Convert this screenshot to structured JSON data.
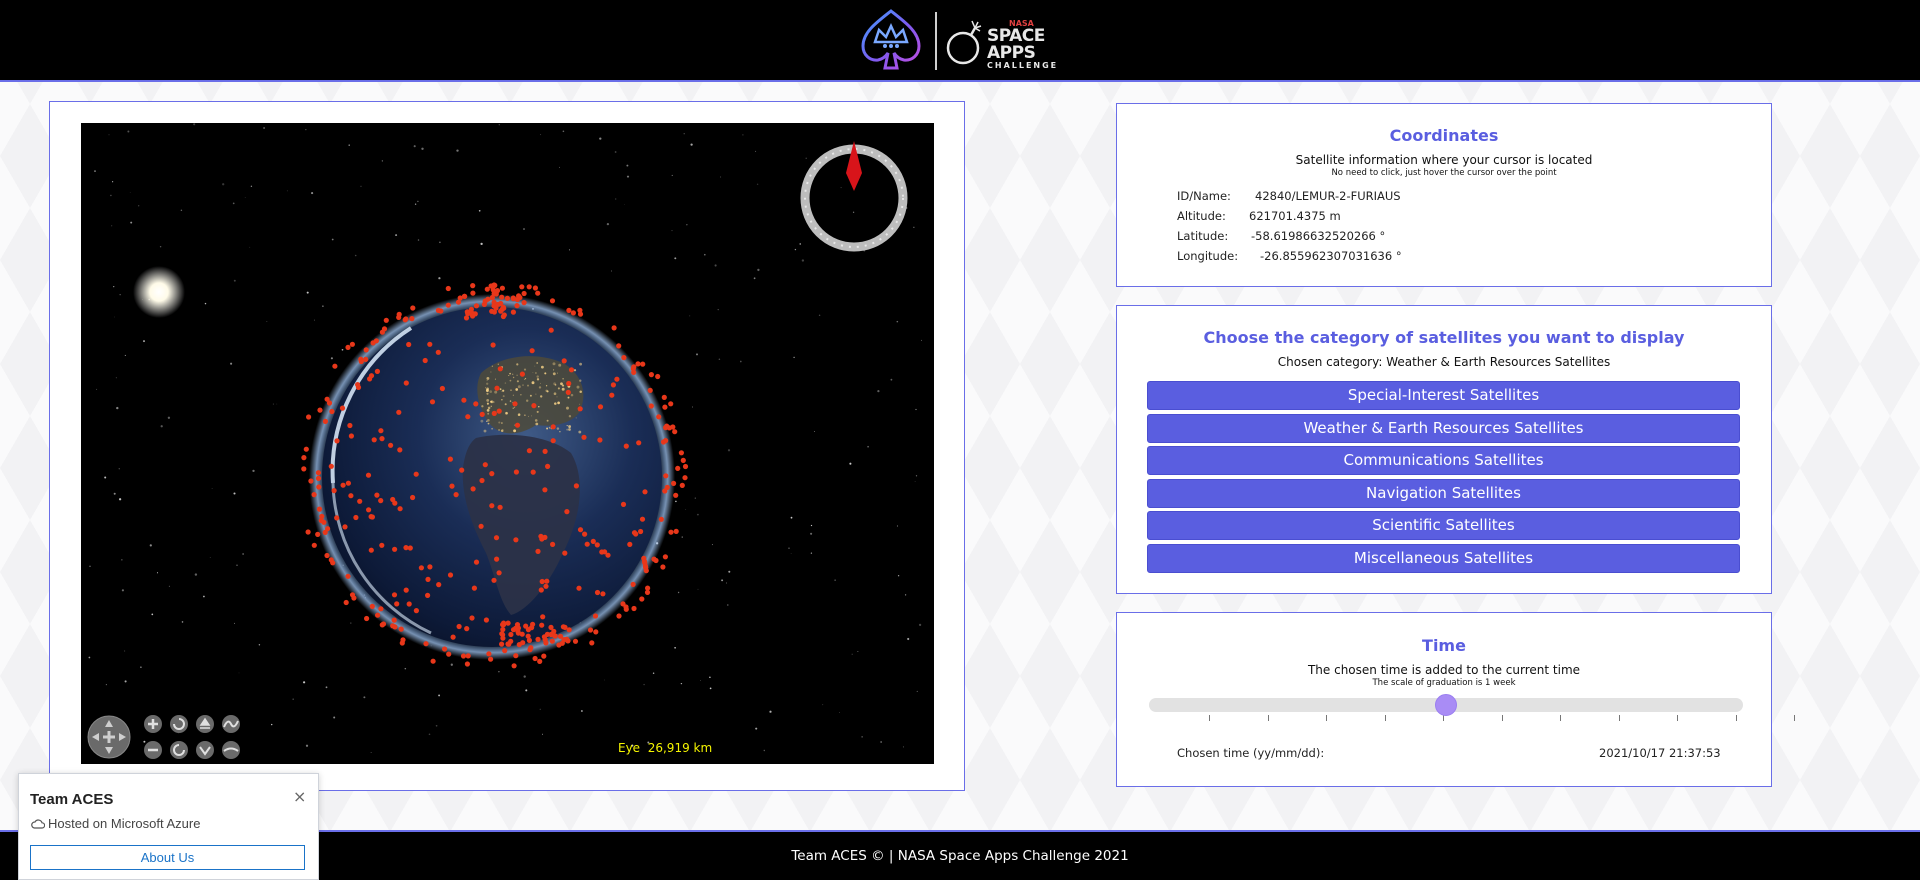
{
  "header": {
    "logo_text_small": "NASA",
    "logo_text_main": "SPACE APPS",
    "logo_text_sub": "CHALLENGE"
  },
  "viewer": {
    "eye_label": "Eye",
    "eye_distance": "26,919 km"
  },
  "coordinates": {
    "title": "Coordinates",
    "subtitle": "Satellite information where your cursor is located",
    "hint": "No need to click, just hover the cursor over the point",
    "rows": [
      {
        "label": "ID/Name:",
        "value": "42840/LEMUR-2-FURIAUS"
      },
      {
        "label": "Altitude:",
        "value": "621701.4375 m"
      },
      {
        "label": "Latitude:",
        "value": "-58.61986632520266 °"
      },
      {
        "label": "Longitude:",
        "value": "-26.855962307031636 °"
      }
    ]
  },
  "category": {
    "title": "Choose the category of satellites you want to display",
    "chosen_label": "Chosen category: Weather & Earth Resources Satellites",
    "buttons": [
      "Special-Interest Satellites",
      "Weather & Earth Resources Satellites",
      "Communications Satellites",
      "Navigation Satellites",
      "Scientific Satellites",
      "Miscellaneous Satellites"
    ]
  },
  "time": {
    "title": "Time",
    "subtitle": "The chosen time is added to the current time",
    "hint": "The scale of graduation is 1 week",
    "slider_position": 0.5,
    "chosen_label": "Chosen time (yy/mm/dd):",
    "chosen_value": "2021/10/17 21:37:53"
  },
  "footer": {
    "text": "Team ACES © | NASA Space Apps Challenge 2021"
  },
  "popup": {
    "title": "Team ACES",
    "close": "×",
    "host": "Hosted on Microsoft Azure",
    "about_button": "About Us"
  },
  "colors": {
    "accent": "#5a5ee0",
    "border": "#6a6ee8",
    "satellite_dot": "#e8371a",
    "eye_text": "#f5f500"
  }
}
